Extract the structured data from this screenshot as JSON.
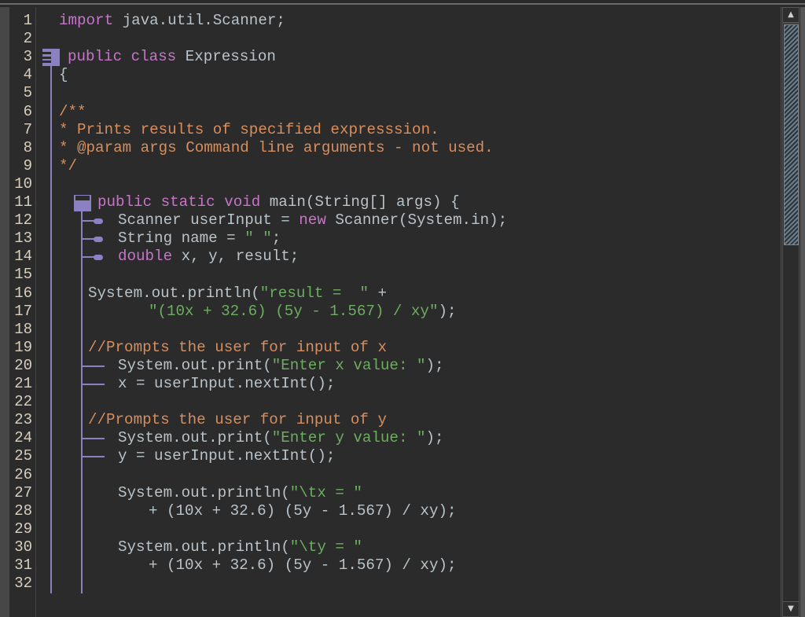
{
  "editor": {
    "language": "java",
    "line_numbers": [
      "1",
      "2",
      "3",
      "4",
      "5",
      "6",
      "7",
      "8",
      "9",
      "10",
      "11",
      "12",
      "13",
      "14",
      "15",
      "16",
      "17",
      "18",
      "19",
      "20",
      "21",
      "22",
      "23",
      "24",
      "25",
      "26",
      "27",
      "28",
      "29",
      "30",
      "31",
      "32"
    ],
    "lines": [
      {
        "n": 1,
        "indent": 0,
        "tokens": [
          {
            "t": "kw",
            "v": "import"
          },
          {
            "t": "tx",
            "v": " java.util.Scanner;"
          }
        ]
      },
      {
        "n": 2,
        "indent": 0,
        "tokens": []
      },
      {
        "n": 3,
        "indent": 1,
        "tokens": [
          {
            "t": "kw",
            "v": "public"
          },
          {
            "t": "tx",
            "v": " "
          },
          {
            "t": "kw",
            "v": "class"
          },
          {
            "t": "tx",
            "v": " Expression"
          }
        ]
      },
      {
        "n": 4,
        "indent": 0,
        "tokens": [
          {
            "t": "tx",
            "v": "{"
          }
        ]
      },
      {
        "n": 5,
        "indent": 0,
        "tokens": []
      },
      {
        "n": 6,
        "indent": 0,
        "tokens": [
          {
            "t": "cm",
            "v": "/**"
          }
        ]
      },
      {
        "n": 7,
        "indent": 0,
        "tokens": [
          {
            "t": "cm",
            "v": "* Prints results of specified expresssion."
          }
        ]
      },
      {
        "n": 8,
        "indent": 0,
        "tokens": [
          {
            "t": "cm",
            "v": "* @param args Command line arguments - not used."
          }
        ]
      },
      {
        "n": 9,
        "indent": 0,
        "tokens": [
          {
            "t": "cm",
            "v": "*/"
          }
        ]
      },
      {
        "n": 10,
        "indent": 0,
        "tokens": []
      },
      {
        "n": 11,
        "indent": 4,
        "tokens": [
          {
            "t": "kw",
            "v": "public"
          },
          {
            "t": "tx",
            "v": " "
          },
          {
            "t": "kw",
            "v": "static"
          },
          {
            "t": "tx",
            "v": " "
          },
          {
            "t": "kw",
            "v": "void"
          },
          {
            "t": "tx",
            "v": " main(String[] args) {"
          }
        ]
      },
      {
        "n": 12,
        "indent": 6,
        "tokens": [
          {
            "t": "tx",
            "v": "Scanner userInput = "
          },
          {
            "t": "kw",
            "v": "new"
          },
          {
            "t": "tx",
            "v": " Scanner(System.in);"
          }
        ]
      },
      {
        "n": 13,
        "indent": 6,
        "tokens": [
          {
            "t": "tx",
            "v": "String name = "
          },
          {
            "t": "str",
            "v": "\" \""
          },
          {
            "t": "tx",
            "v": ";"
          }
        ]
      },
      {
        "n": 14,
        "indent": 6,
        "tokens": [
          {
            "t": "kw",
            "v": "double"
          },
          {
            "t": "tx",
            "v": " x, y, result;"
          }
        ]
      },
      {
        "n": 15,
        "indent": 0,
        "tokens": []
      },
      {
        "n": 16,
        "indent": 3,
        "tokens": [
          {
            "t": "tx",
            "v": "System.out.println("
          },
          {
            "t": "str",
            "v": "\"result =  \""
          },
          {
            "t": "tx",
            "v": " +"
          }
        ]
      },
      {
        "n": 17,
        "indent": 9,
        "tokens": [
          {
            "t": "str",
            "v": "\"(10x + 32.6) (5y - 1.567) / xy\""
          },
          {
            "t": "tx",
            "v": ");"
          }
        ]
      },
      {
        "n": 18,
        "indent": 0,
        "tokens": []
      },
      {
        "n": 19,
        "indent": 3,
        "tokens": [
          {
            "t": "cm",
            "v": "//Prompts the user for input of x"
          }
        ]
      },
      {
        "n": 20,
        "indent": 6,
        "tokens": [
          {
            "t": "tx",
            "v": "System.out.print("
          },
          {
            "t": "str",
            "v": "\"Enter x value: \""
          },
          {
            "t": "tx",
            "v": ");"
          }
        ]
      },
      {
        "n": 21,
        "indent": 6,
        "tokens": [
          {
            "t": "tx",
            "v": "x = userInput.nextInt();"
          }
        ]
      },
      {
        "n": 22,
        "indent": 0,
        "tokens": []
      },
      {
        "n": 23,
        "indent": 3,
        "tokens": [
          {
            "t": "cm",
            "v": "//Prompts the user for input of y"
          }
        ]
      },
      {
        "n": 24,
        "indent": 6,
        "tokens": [
          {
            "t": "tx",
            "v": "System.out.print("
          },
          {
            "t": "str",
            "v": "\"Enter y value: \""
          },
          {
            "t": "tx",
            "v": ");"
          }
        ]
      },
      {
        "n": 25,
        "indent": 6,
        "tokens": [
          {
            "t": "tx",
            "v": "y = userInput.nextInt();"
          }
        ]
      },
      {
        "n": 26,
        "indent": 0,
        "tokens": []
      },
      {
        "n": 27,
        "indent": 6,
        "tokens": [
          {
            "t": "tx",
            "v": "System.out.println("
          },
          {
            "t": "str",
            "v": "\"\\tx = \""
          }
        ]
      },
      {
        "n": 28,
        "indent": 9,
        "tokens": [
          {
            "t": "tx",
            "v": "+ (10x + 32.6) (5y - 1.567) / xy);"
          }
        ]
      },
      {
        "n": 29,
        "indent": 0,
        "tokens": []
      },
      {
        "n": 30,
        "indent": 6,
        "tokens": [
          {
            "t": "tx",
            "v": "System.out.println("
          },
          {
            "t": "str",
            "v": "\"\\ty = \""
          }
        ]
      },
      {
        "n": 31,
        "indent": 9,
        "tokens": [
          {
            "t": "tx",
            "v": "+ (10x + 32.6) (5y - 1.567) / xy);"
          }
        ]
      },
      {
        "n": 32,
        "indent": 0,
        "tokens": []
      }
    ]
  },
  "colors": {
    "keyword": "#c775c9",
    "text": "#b9c3ca",
    "comment": "#d88e5e",
    "string": "#6cae5f",
    "structure": "#8a80c2",
    "line_number": "#d8cfbd",
    "background": "#2b2b2b"
  },
  "scrollbar": {
    "up_icon": "▲",
    "down_icon": "▼",
    "thumb_position_fraction": 0.0,
    "visible_fraction": 0.38
  }
}
